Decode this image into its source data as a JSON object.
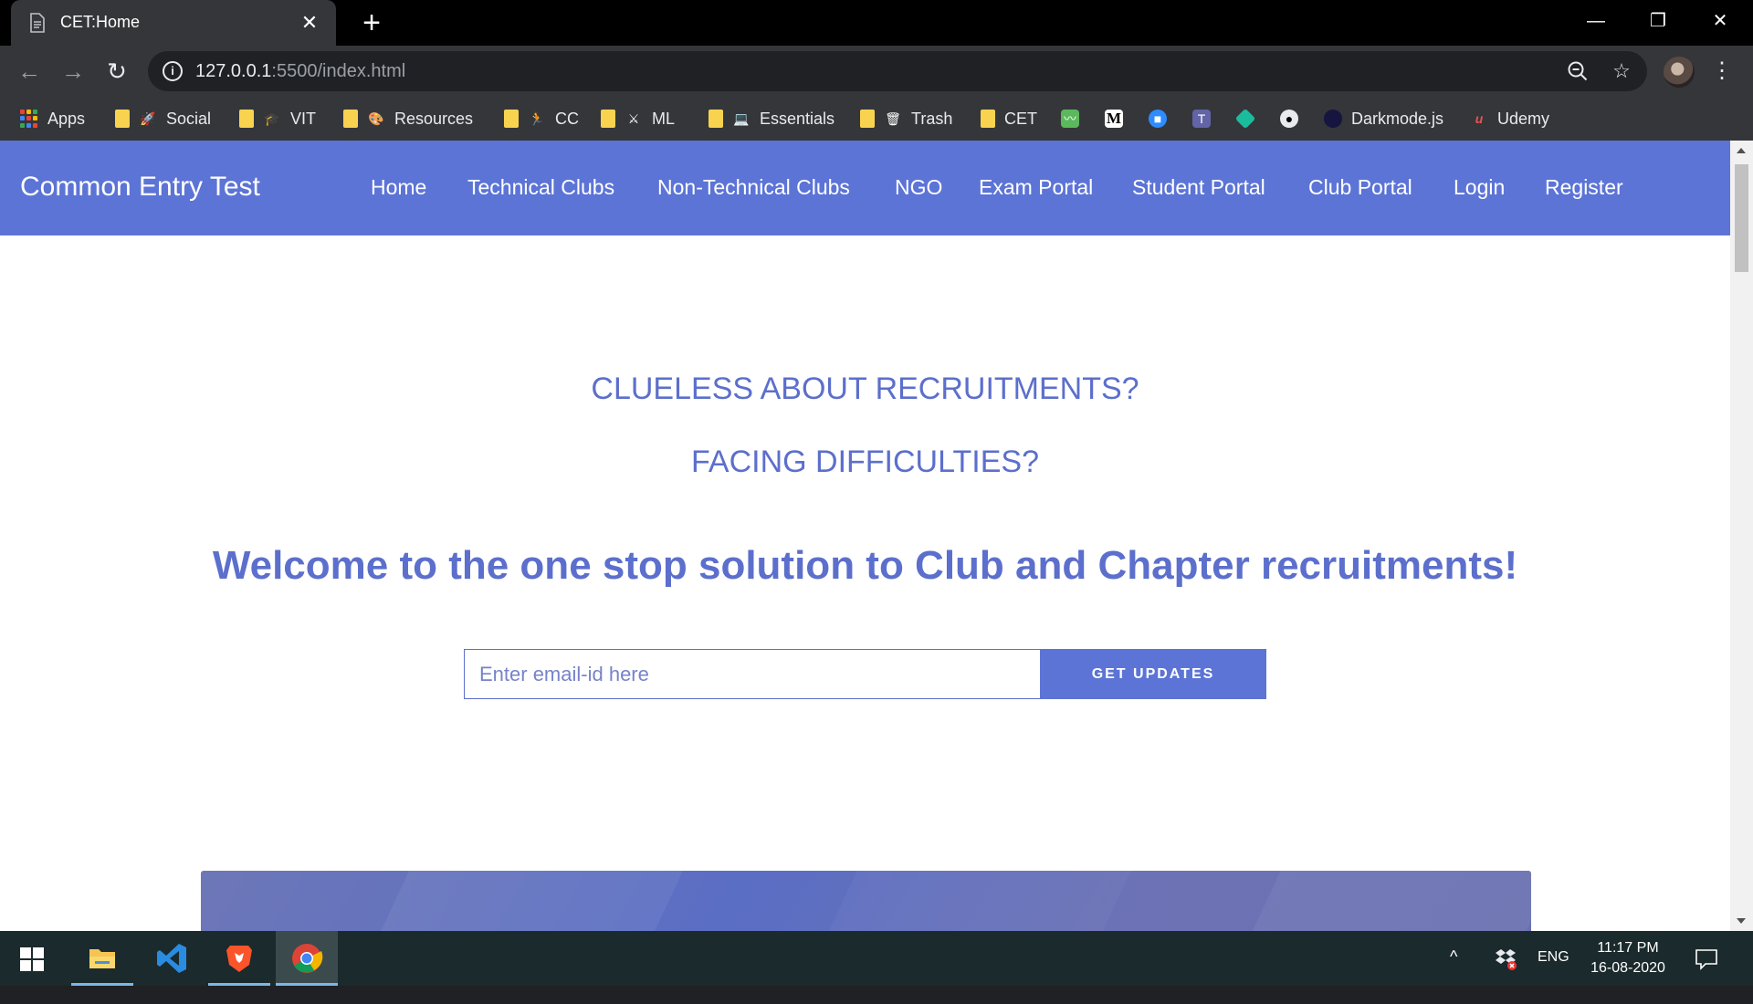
{
  "browser": {
    "tab": {
      "title": "CET:Home",
      "close": "✕"
    },
    "new_tab": "+",
    "window_controls": {
      "minimize": "—",
      "restore": "❐",
      "close": "✕"
    },
    "toolbar": {
      "back": "←",
      "forward": "→",
      "reload": "↻",
      "url_host": "127.0.0.1",
      "url_rest": ":5500/index.html",
      "zoom_icon": "🔍",
      "star_icon": "☆",
      "menu_icon": "⋮"
    },
    "bookmarks": [
      {
        "label": "Apps",
        "icon": "apps-grid-icon"
      },
      {
        "label": "Social",
        "icon": "rocket-icon"
      },
      {
        "label": "VIT",
        "icon": "graduation-cap-icon"
      },
      {
        "label": "Resources",
        "icon": "palette-icon"
      },
      {
        "label": "CC",
        "icon": "runner-icon"
      },
      {
        "label": "ML",
        "icon": "crossed-swords-icon"
      },
      {
        "label": "Essentials",
        "icon": "laptop-icon"
      },
      {
        "label": "Trash",
        "icon": "trash-icon"
      },
      {
        "label": "CET",
        "icon": "folder-icon"
      },
      {
        "label": "Darkmode.js",
        "icon": "darkmode-icon"
      },
      {
        "label": "Udemy",
        "icon": "udemy-icon"
      }
    ]
  },
  "site": {
    "brand": "Common Entry Test",
    "nav": [
      "Home",
      "Technical Clubs",
      "Non-Technical Clubs",
      "NGO",
      "Exam Portal",
      "Student Portal",
      "Club Portal",
      "Login",
      "Register"
    ],
    "question_1": "CLUELESS ABOUT RECRUITMENTS?",
    "question_2": "FACING DIFFICULTIES?",
    "welcome": "Welcome to the one stop solution to Club and Chapter recruitments!",
    "email_placeholder": "Enter email-id here",
    "cta": "GET UPDATES",
    "accent_color": "#5c74d6"
  },
  "taskbar": {
    "apps": [
      "file-explorer-icon",
      "vscode-icon",
      "brave-icon",
      "chrome-icon"
    ],
    "language": "ENG",
    "time": "11:17 PM",
    "date": "16-08-2020",
    "chevron": "^"
  }
}
